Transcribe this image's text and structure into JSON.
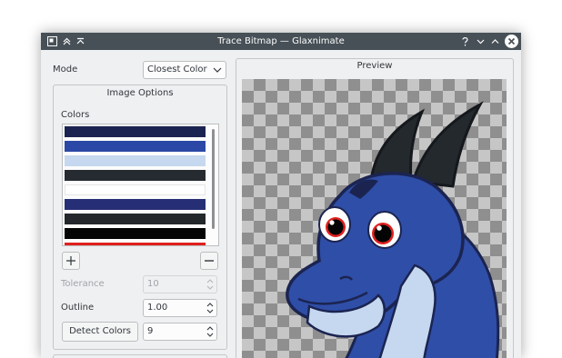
{
  "window": {
    "title": "Trace Bitmap — Glaxnimate"
  },
  "mode": {
    "label": "Mode",
    "value": "Closest Color"
  },
  "image_options": {
    "title": "Image Options",
    "colors_label": "Colors",
    "colors": [
      "#1b2451",
      "#2c48a6",
      "#c5d8ef",
      "#262b31",
      "#ffffff",
      "#262f75",
      "#24282d",
      "#040405",
      "#e0201e"
    ],
    "add_label": "+",
    "remove_label": "−",
    "tolerance_label": "Tolerance",
    "tolerance_value": "10",
    "outline_label": "Outline",
    "outline_value": "1.00",
    "detect_label": "Detect Colors",
    "detect_value": "9"
  },
  "preview": {
    "title": "Preview"
  },
  "colors": {
    "titlebar": "#475057",
    "window_bg": "#eff0f1",
    "dragon_blue": "#2f4ea7",
    "dragon_dark": "#1b2451",
    "dragon_light": "#c5d8ef",
    "horn": "#24292e",
    "eye_red": "#e0201e"
  }
}
